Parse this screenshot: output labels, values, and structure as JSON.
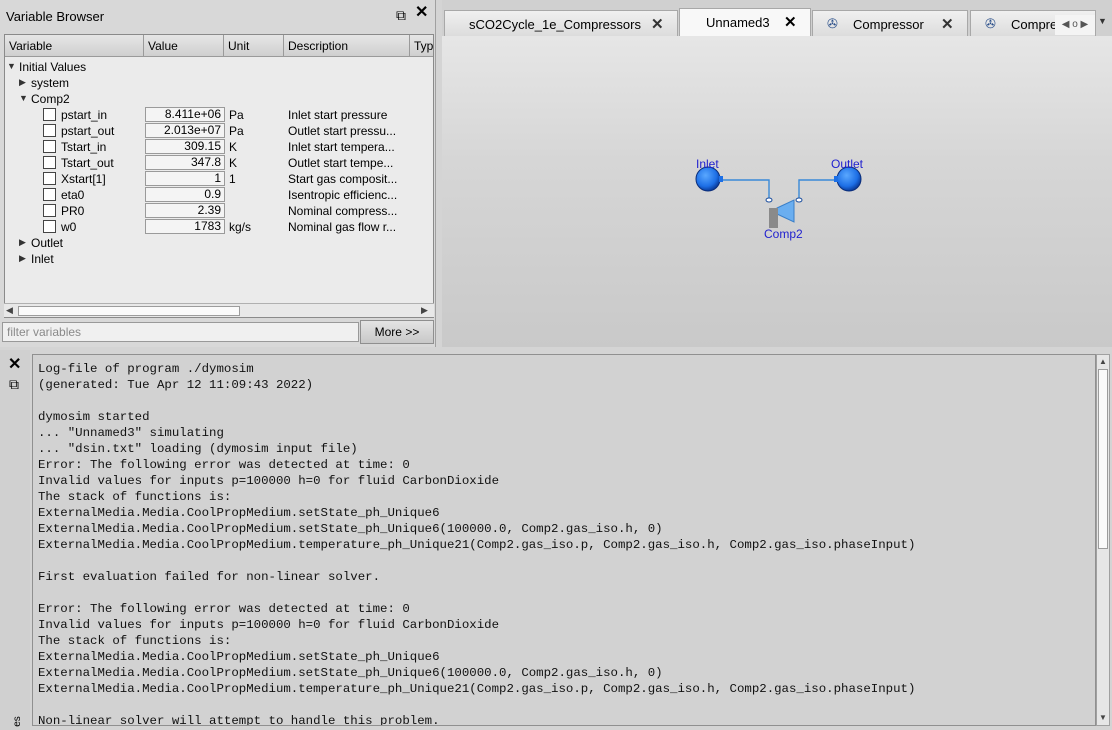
{
  "variable_browser": {
    "title": "Variable Browser",
    "columns": [
      "Variable",
      "Value",
      "Unit",
      "Description",
      "Typ"
    ],
    "tree": {
      "initial_values": "Initial Values",
      "system": "system",
      "comp2": "Comp2",
      "outlet": "Outlet",
      "inlet": "Inlet"
    },
    "rows": [
      {
        "name": "pstart_in",
        "value": "8.411e+06",
        "unit": "Pa",
        "desc": "Inlet start pressure"
      },
      {
        "name": "pstart_out",
        "value": "2.013e+07",
        "unit": "Pa",
        "desc": "Outlet start pressu..."
      },
      {
        "name": "Tstart_in",
        "value": "309.15",
        "unit": "K",
        "desc": "Inlet start tempera..."
      },
      {
        "name": "Tstart_out",
        "value": "347.8",
        "unit": "K",
        "desc": "Outlet start tempe..."
      },
      {
        "name": "Xstart[1]",
        "value": "1",
        "unit": "1",
        "desc": "Start gas composit..."
      },
      {
        "name": "eta0",
        "value": "0.9",
        "unit": "",
        "desc": "Isentropic efficienc..."
      },
      {
        "name": "PR0",
        "value": "2.39",
        "unit": "",
        "desc": "Nominal compress..."
      },
      {
        "name": "w0",
        "value": "1783",
        "unit": "kg/s",
        "desc": "Nominal gas flow r..."
      }
    ],
    "filter_placeholder": "filter variables",
    "more_button": "More >>"
  },
  "tabs": [
    {
      "label": "sCO2Cycle_1e_Compressors",
      "active": false,
      "icon": false
    },
    {
      "label": "Unnamed3",
      "active": true,
      "icon": false
    },
    {
      "label": "Compressor",
      "active": false,
      "icon": true
    },
    {
      "label": "Compre",
      "active": false,
      "icon": true
    }
  ],
  "diagram": {
    "inlet_label": "Inlet",
    "outlet_label": "Outlet",
    "component_label": "Comp2",
    "colors": {
      "port": "#1e6fe0",
      "wire": "#3a8ad8",
      "label": "#1f1fcf",
      "compressor": "#4a9ae8"
    }
  },
  "log": {
    "side_label": "es",
    "lines": [
      "Log-file of program ./dymosim",
      "(generated: Tue Apr 12 11:09:43 2022)",
      "",
      "dymosim started",
      "... \"Unnamed3\" simulating",
      "... \"dsin.txt\" loading (dymosim input file)",
      "Error: The following error was detected at time: 0",
      "Invalid values for inputs p=100000 h=0 for fluid CarbonDioxide",
      "The stack of functions is:",
      "ExternalMedia.Media.CoolPropMedium.setState_ph_Unique6",
      "ExternalMedia.Media.CoolPropMedium.setState_ph_Unique6(100000.0, Comp2.gas_iso.h, 0)",
      "ExternalMedia.Media.CoolPropMedium.temperature_ph_Unique21(Comp2.gas_iso.p, Comp2.gas_iso.h, Comp2.gas_iso.phaseInput)",
      "",
      "First evaluation failed for non-linear solver.",
      "",
      "Error: The following error was detected at time: 0",
      "Invalid values for inputs p=100000 h=0 for fluid CarbonDioxide",
      "The stack of functions is:",
      "ExternalMedia.Media.CoolPropMedium.setState_ph_Unique6",
      "ExternalMedia.Media.CoolPropMedium.setState_ph_Unique6(100000.0, Comp2.gas_iso.h, 0)",
      "ExternalMedia.Media.CoolPropMedium.temperature_ph_Unique21(Comp2.gas_iso.p, Comp2.gas_iso.h, Comp2.gas_iso.phaseInput)",
      "",
      "Non-linear solver will attempt to handle this problem."
    ]
  }
}
